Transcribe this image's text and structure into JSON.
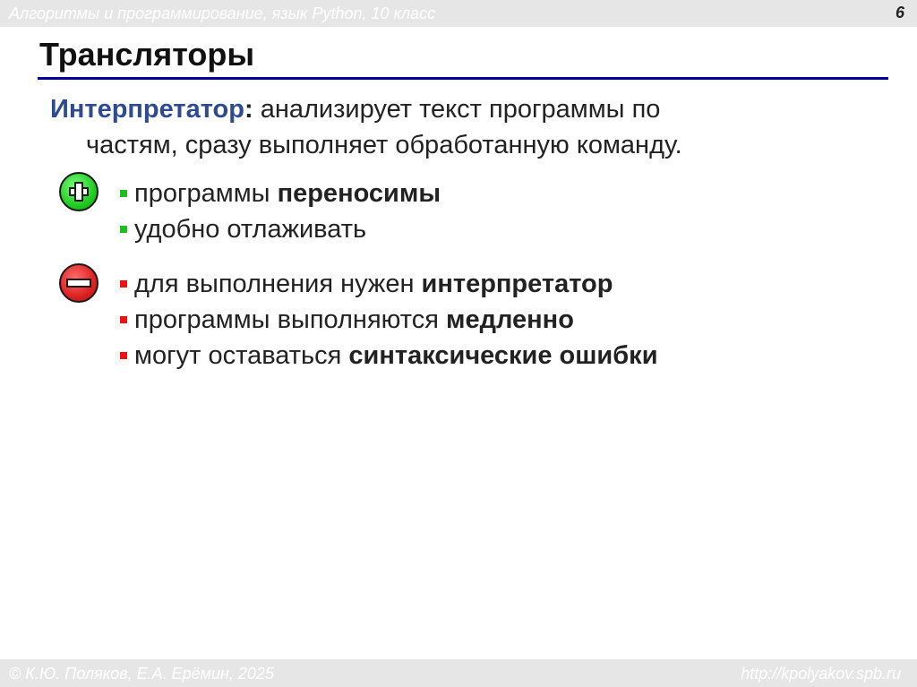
{
  "header": {
    "course_title": "Алгоритмы и программирование, язык Python, 10 класс",
    "page_number": "6"
  },
  "slide": {
    "title": "Трансляторы",
    "definition": {
      "term": "Интерпретатор",
      "colon": ":",
      "line1_rest": " анализирует текст программы по",
      "line2": "частям, сразу выполняет обработанную команду."
    },
    "pros": {
      "icon": "plus-icon",
      "items": [
        {
          "text": "программы ",
          "bold": "переносимы"
        },
        {
          "text": "удобно отлаживать",
          "bold": ""
        }
      ]
    },
    "cons": {
      "icon": "minus-icon",
      "items": [
        {
          "text": "для выполнения нужен ",
          "bold": "интерпретатор"
        },
        {
          "text": "программы выполняются ",
          "bold": "медленно"
        },
        {
          "text": "могут оставаться ",
          "bold": "синтаксические ошибки"
        }
      ]
    }
  },
  "footer": {
    "copyright": "© К.Ю. Поляков, Е.А. Ерёмин, 2025",
    "url": "http://kpolyakov.spb.ru"
  },
  "colors": {
    "term": "#2e4b8f",
    "rule": "#000099",
    "plus": "#22cc22",
    "minus": "#dd2222",
    "bar": "#e6e6e6"
  }
}
